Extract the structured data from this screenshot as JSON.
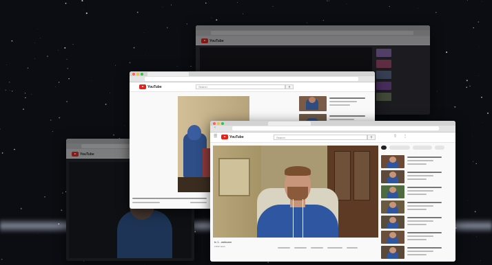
{
  "windows": {
    "back": {
      "logo_text": "YouTube"
    },
    "left": {
      "logo_text": "YouTube"
    },
    "middle": {
      "logo_text": "YouTube",
      "search_placeholder": "Search"
    },
    "front": {
      "logo_text": "YouTube",
      "search_placeholder": "Search",
      "video_title": "tv 1 - webcam",
      "video_meta": "2,832 views",
      "action_buttons": [
        "like",
        "dislike",
        "share",
        "save",
        "more"
      ],
      "chips": [
        "All",
        "Recommended",
        "Webcam",
        "Related"
      ],
      "sidebar_count": 7
    }
  },
  "colors": {
    "background": "#0b0d12",
    "youtube_red": "#e62117",
    "chrome": "#e4e4e4"
  }
}
